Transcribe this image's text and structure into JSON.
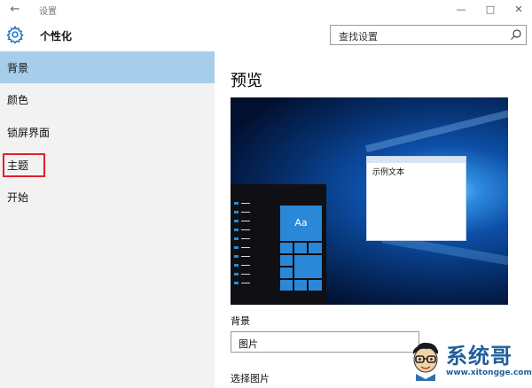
{
  "titlebar": {
    "title": "设置",
    "back_icon": "back-arrow-icon",
    "controls": [
      "minimize-icon",
      "maximize-icon",
      "close-icon"
    ]
  },
  "header": {
    "app_name": "个性化",
    "icon": "gear-icon",
    "search": {
      "placeholder": "查找设置",
      "icon": "search-icon"
    }
  },
  "sidebar": {
    "items": [
      {
        "label": "背景",
        "selected": true
      },
      {
        "label": "颜色",
        "selected": false
      },
      {
        "label": "锁屏界面",
        "selected": false
      },
      {
        "label": "主题",
        "selected": false,
        "highlighted": true
      },
      {
        "label": "开始",
        "selected": false
      }
    ]
  },
  "main": {
    "title": "预览",
    "preview": {
      "tile_label": "Aa",
      "sample_window_text": "示例文本"
    },
    "background_label": "背景",
    "background_value": "图片",
    "choose_picture_label": "选择图片"
  },
  "watermark": {
    "title": "系统哥",
    "url": "www.xitongge.com"
  },
  "colors": {
    "selected_item": "#a6cdea",
    "sidebar_bg": "#f2f2f2",
    "highlight_box": "#e0212c",
    "tile_blue": "#2b88d8"
  }
}
